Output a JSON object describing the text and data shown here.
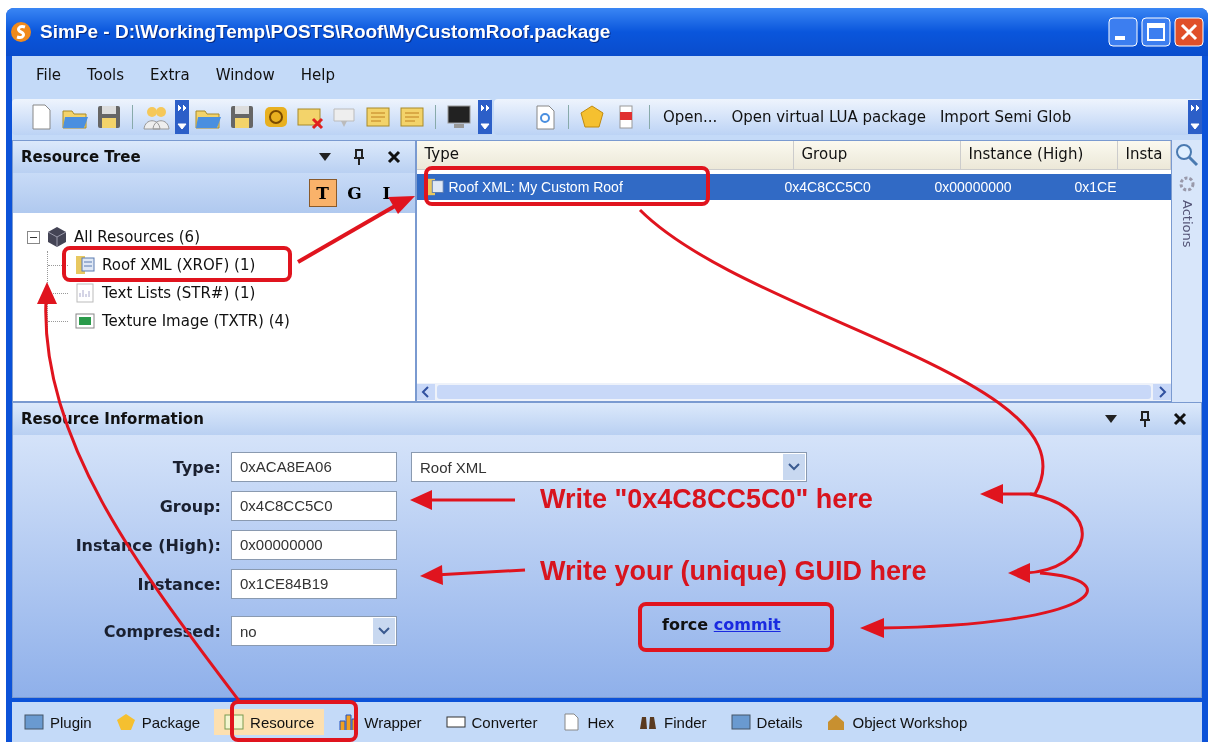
{
  "window": {
    "title": "SimPe - D:\\WorkingTemp\\POSTS\\Roof\\MyCustomRoof.package"
  },
  "menu": [
    "File",
    "Tools",
    "Extra",
    "Window",
    "Help"
  ],
  "toolbar": {
    "text_buttons": [
      "Open...",
      "Open virtual LUA package",
      "Import Semi Glob"
    ]
  },
  "resource_tree": {
    "title": "Resource Tree",
    "view_buttons": [
      {
        "label": "T",
        "selected": true
      },
      {
        "label": "G",
        "selected": false
      },
      {
        "label": "I",
        "selected": false
      }
    ],
    "root": {
      "label": "All Resources (6)",
      "expanded": true,
      "children": [
        {
          "label": "Roof XML (XROF) (1)",
          "kind": "xml"
        },
        {
          "label": "Text Lists (STR#) (1)",
          "kind": "text"
        },
        {
          "label": "Texture Image (TXTR) (4)",
          "kind": "image"
        }
      ]
    }
  },
  "resource_list": {
    "columns": [
      "Type",
      "Group",
      "Instance (High)",
      "Insta"
    ],
    "rows": [
      {
        "cells": [
          "Roof XML: My Custom Roof",
          "0x4C8CC5C0",
          "0x00000000",
          "0x1CE"
        ],
        "selected": true
      }
    ]
  },
  "side_panel": {
    "label": "Actions"
  },
  "resource_info": {
    "title": "Resource Information",
    "fields": [
      {
        "label": "Type:",
        "value": "0xACA8EA06",
        "kind": "text"
      },
      {
        "label": "Group:",
        "value": "0x4C8CC5C0",
        "kind": "text"
      },
      {
        "label": "Instance (High):",
        "value": "0x00000000",
        "kind": "text"
      },
      {
        "label": "Instance:",
        "value": "0x1CE84B19",
        "kind": "text"
      },
      {
        "label": "Compressed:",
        "value": "no",
        "kind": "select"
      }
    ],
    "type_name": "Roof XML",
    "commit": {
      "prefix": "force",
      "link": "commit"
    }
  },
  "annotations": [
    {
      "text": "Write \"0x4C8CC5C0\" here"
    },
    {
      "text": "Write your (unique) GUID here"
    }
  ],
  "bottom_tabs": [
    {
      "label": "Plugin",
      "selected": false
    },
    {
      "label": "Package",
      "selected": false
    },
    {
      "label": "Resource",
      "selected": true
    },
    {
      "label": "Wrapper",
      "selected": false
    },
    {
      "label": "Converter",
      "selected": false
    },
    {
      "label": "Hex",
      "selected": false
    },
    {
      "label": "Finder",
      "selected": false
    },
    {
      "label": "Details",
      "selected": false
    },
    {
      "label": "Object Workshop",
      "selected": false
    }
  ]
}
